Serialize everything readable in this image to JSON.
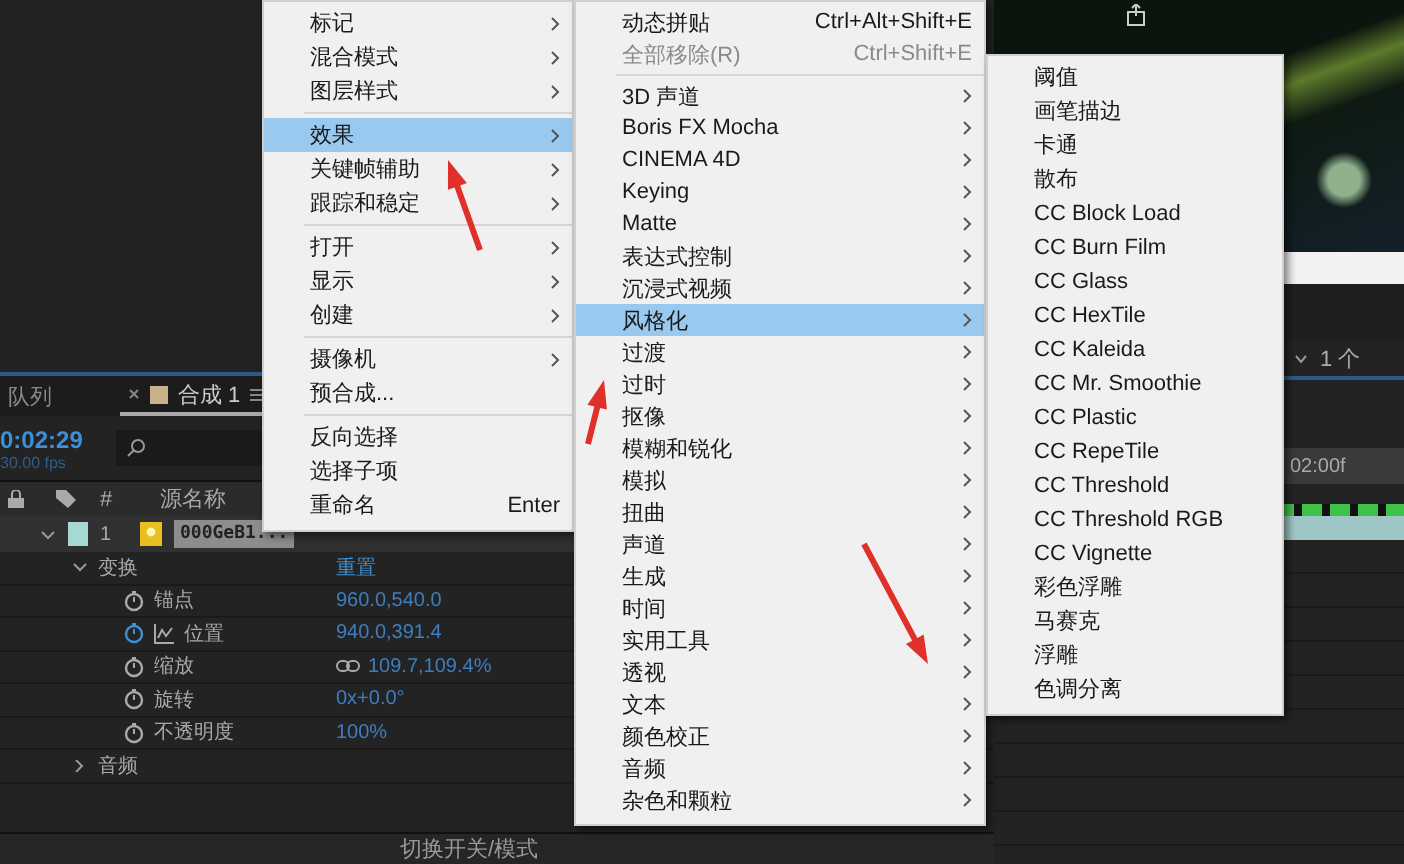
{
  "menus": [
    {
      "items": [
        {
          "kind": "item",
          "label": "标记",
          "submenu": true,
          "selected": false
        },
        {
          "kind": "item",
          "label": "混合模式",
          "submenu": true,
          "selected": false
        },
        {
          "kind": "item",
          "label": "图层样式",
          "submenu": true,
          "selected": false
        },
        {
          "kind": "separator"
        },
        {
          "kind": "item",
          "label": "效果",
          "submenu": true,
          "selected": true
        },
        {
          "kind": "item",
          "label": "关键帧辅助",
          "submenu": true,
          "selected": false
        },
        {
          "kind": "item",
          "label": "跟踪和稳定",
          "submenu": true,
          "selected": false
        },
        {
          "kind": "separator"
        },
        {
          "kind": "item",
          "label": "打开",
          "submenu": true,
          "selected": false
        },
        {
          "kind": "item",
          "label": "显示",
          "submenu": true,
          "selected": false
        },
        {
          "kind": "item",
          "label": "创建",
          "submenu": true,
          "selected": false
        },
        {
          "kind": "separator"
        },
        {
          "kind": "item",
          "label": "摄像机",
          "submenu": true,
          "selected": false
        },
        {
          "kind": "item",
          "label": "预合成...",
          "submenu": false,
          "selected": false
        },
        {
          "kind": "separator"
        },
        {
          "kind": "item",
          "label": "反向选择",
          "submenu": false,
          "selected": false
        },
        {
          "kind": "item",
          "label": "选择子项",
          "submenu": false,
          "selected": false
        },
        {
          "kind": "item",
          "label": "重命名",
          "shortcut": "Enter",
          "submenu": false,
          "selected": false
        }
      ]
    },
    {
      "items": [
        {
          "kind": "item",
          "label": "动态拼贴",
          "shortcut": "Ctrl+Alt+Shift+E",
          "submenu": false,
          "selected": false,
          "disabled": false
        },
        {
          "kind": "item",
          "label": "全部移除(R)",
          "shortcut": "Ctrl+Shift+E",
          "submenu": false,
          "selected": false,
          "disabled": true
        },
        {
          "kind": "separator"
        },
        {
          "kind": "item",
          "label": "3D 声道",
          "submenu": true,
          "selected": false,
          "disabled": false
        },
        {
          "kind": "item",
          "label": "Boris FX Mocha",
          "submenu": true,
          "selected": false,
          "disabled": false
        },
        {
          "kind": "item",
          "label": "CINEMA 4D",
          "submenu": true,
          "selected": false,
          "disabled": false
        },
        {
          "kind": "item",
          "label": "Keying",
          "submenu": true,
          "selected": false,
          "disabled": false
        },
        {
          "kind": "item",
          "label": "Matte",
          "submenu": true,
          "selected": false,
          "disabled": false
        },
        {
          "kind": "item",
          "label": "表达式控制",
          "submenu": true,
          "selected": false,
          "disabled": false
        },
        {
          "kind": "item",
          "label": "沉浸式视频",
          "submenu": true,
          "selected": false,
          "disabled": false
        },
        {
          "kind": "item",
          "label": "风格化",
          "submenu": true,
          "selected": true,
          "disabled": false
        },
        {
          "kind": "item",
          "label": "过渡",
          "submenu": true,
          "selected": false,
          "disabled": false
        },
        {
          "kind": "item",
          "label": "过时",
          "submenu": true,
          "selected": false,
          "disabled": false
        },
        {
          "kind": "item",
          "label": "抠像",
          "submenu": true,
          "selected": false,
          "disabled": false
        },
        {
          "kind": "item",
          "label": "模糊和锐化",
          "submenu": true,
          "selected": false,
          "disabled": false
        },
        {
          "kind": "item",
          "label": "模拟",
          "submenu": true,
          "selected": false,
          "disabled": false
        },
        {
          "kind": "item",
          "label": "扭曲",
          "submenu": true,
          "selected": false,
          "disabled": false
        },
        {
          "kind": "item",
          "label": "声道",
          "submenu": true,
          "selected": false,
          "disabled": false
        },
        {
          "kind": "item",
          "label": "生成",
          "submenu": true,
          "selected": false,
          "disabled": false
        },
        {
          "kind": "item",
          "label": "时间",
          "submenu": true,
          "selected": false,
          "disabled": false
        },
        {
          "kind": "item",
          "label": "实用工具",
          "submenu": true,
          "selected": false,
          "disabled": false
        },
        {
          "kind": "item",
          "label": "透视",
          "submenu": true,
          "selected": false,
          "disabled": false
        },
        {
          "kind": "item",
          "label": "文本",
          "submenu": true,
          "selected": false,
          "disabled": false
        },
        {
          "kind": "item",
          "label": "颜色校正",
          "submenu": true,
          "selected": false,
          "disabled": false
        },
        {
          "kind": "item",
          "label": "音频",
          "submenu": true,
          "selected": false,
          "disabled": false
        },
        {
          "kind": "item",
          "label": "杂色和颗粒",
          "submenu": true,
          "selected": false,
          "disabled": false
        }
      ]
    },
    {
      "items": [
        {
          "kind": "item",
          "label": "阈值",
          "submenu": false,
          "selected": false
        },
        {
          "kind": "item",
          "label": "画笔描边",
          "submenu": false,
          "selected": false
        },
        {
          "kind": "item",
          "label": "卡通",
          "submenu": false,
          "selected": false
        },
        {
          "kind": "item",
          "label": "散布",
          "submenu": false,
          "selected": false
        },
        {
          "kind": "item",
          "label": "CC Block Load",
          "submenu": false,
          "selected": false
        },
        {
          "kind": "item",
          "label": "CC Burn Film",
          "submenu": false,
          "selected": false
        },
        {
          "kind": "item",
          "label": "CC Glass",
          "submenu": false,
          "selected": false
        },
        {
          "kind": "item",
          "label": "CC HexTile",
          "submenu": false,
          "selected": false
        },
        {
          "kind": "item",
          "label": "CC Kaleida",
          "submenu": false,
          "selected": false
        },
        {
          "kind": "item",
          "label": "CC Mr. Smoothie",
          "submenu": false,
          "selected": false
        },
        {
          "kind": "item",
          "label": "CC Plastic",
          "submenu": false,
          "selected": false
        },
        {
          "kind": "item",
          "label": "CC RepeTile",
          "submenu": false,
          "selected": false
        },
        {
          "kind": "item",
          "label": "CC Threshold",
          "submenu": false,
          "selected": false
        },
        {
          "kind": "item",
          "label": "CC Threshold RGB",
          "submenu": false,
          "selected": false
        },
        {
          "kind": "item",
          "label": "CC Vignette",
          "submenu": false,
          "selected": false
        },
        {
          "kind": "item",
          "label": "彩色浮雕",
          "submenu": false,
          "selected": false
        },
        {
          "kind": "item",
          "label": "马赛克",
          "submenu": false,
          "selected": false
        },
        {
          "kind": "item",
          "label": "浮雕",
          "submenu": false,
          "selected": false
        },
        {
          "kind": "item",
          "label": "色调分离",
          "submenu": false,
          "selected": false
        }
      ]
    }
  ],
  "timeline": {
    "tabs": [
      {
        "kind": "panel",
        "label": "队列",
        "selected": false
      },
      {
        "kind": "composition",
        "label": "合成 1",
        "selected": true
      }
    ],
    "timecode": "0:02:29",
    "fps": "30.00 fps",
    "columns": [
      "#",
      "源名称"
    ],
    "layer": {
      "number": "1",
      "name": "000GeB1...",
      "expanded": true
    },
    "properties": [
      {
        "kind": "group",
        "name": "变换",
        "expanded": true,
        "action": "重置",
        "children": [
          {
            "kind": "property",
            "name": "锚点",
            "value": "960.0,540.0",
            "keyframed": false,
            "linked": false
          },
          {
            "kind": "property",
            "name": "位置",
            "value": "940.0,391.4",
            "keyframed": true,
            "linked": false
          },
          {
            "kind": "property",
            "name": "缩放",
            "value": "109.7,109.4%",
            "keyframed": false,
            "linked": true
          },
          {
            "kind": "property",
            "name": "旋转",
            "value": "0x+0.0°",
            "keyframed": false,
            "linked": false
          },
          {
            "kind": "property",
            "name": "不透明度",
            "value": "100%",
            "keyframed": false,
            "linked": false
          }
        ]
      },
      {
        "kind": "group",
        "name": "音频",
        "expanded": false
      }
    ],
    "footer": "切换开关/模式"
  },
  "preview_panel": {
    "view_menu": "1 个",
    "ruler_label": "02:00f"
  }
}
